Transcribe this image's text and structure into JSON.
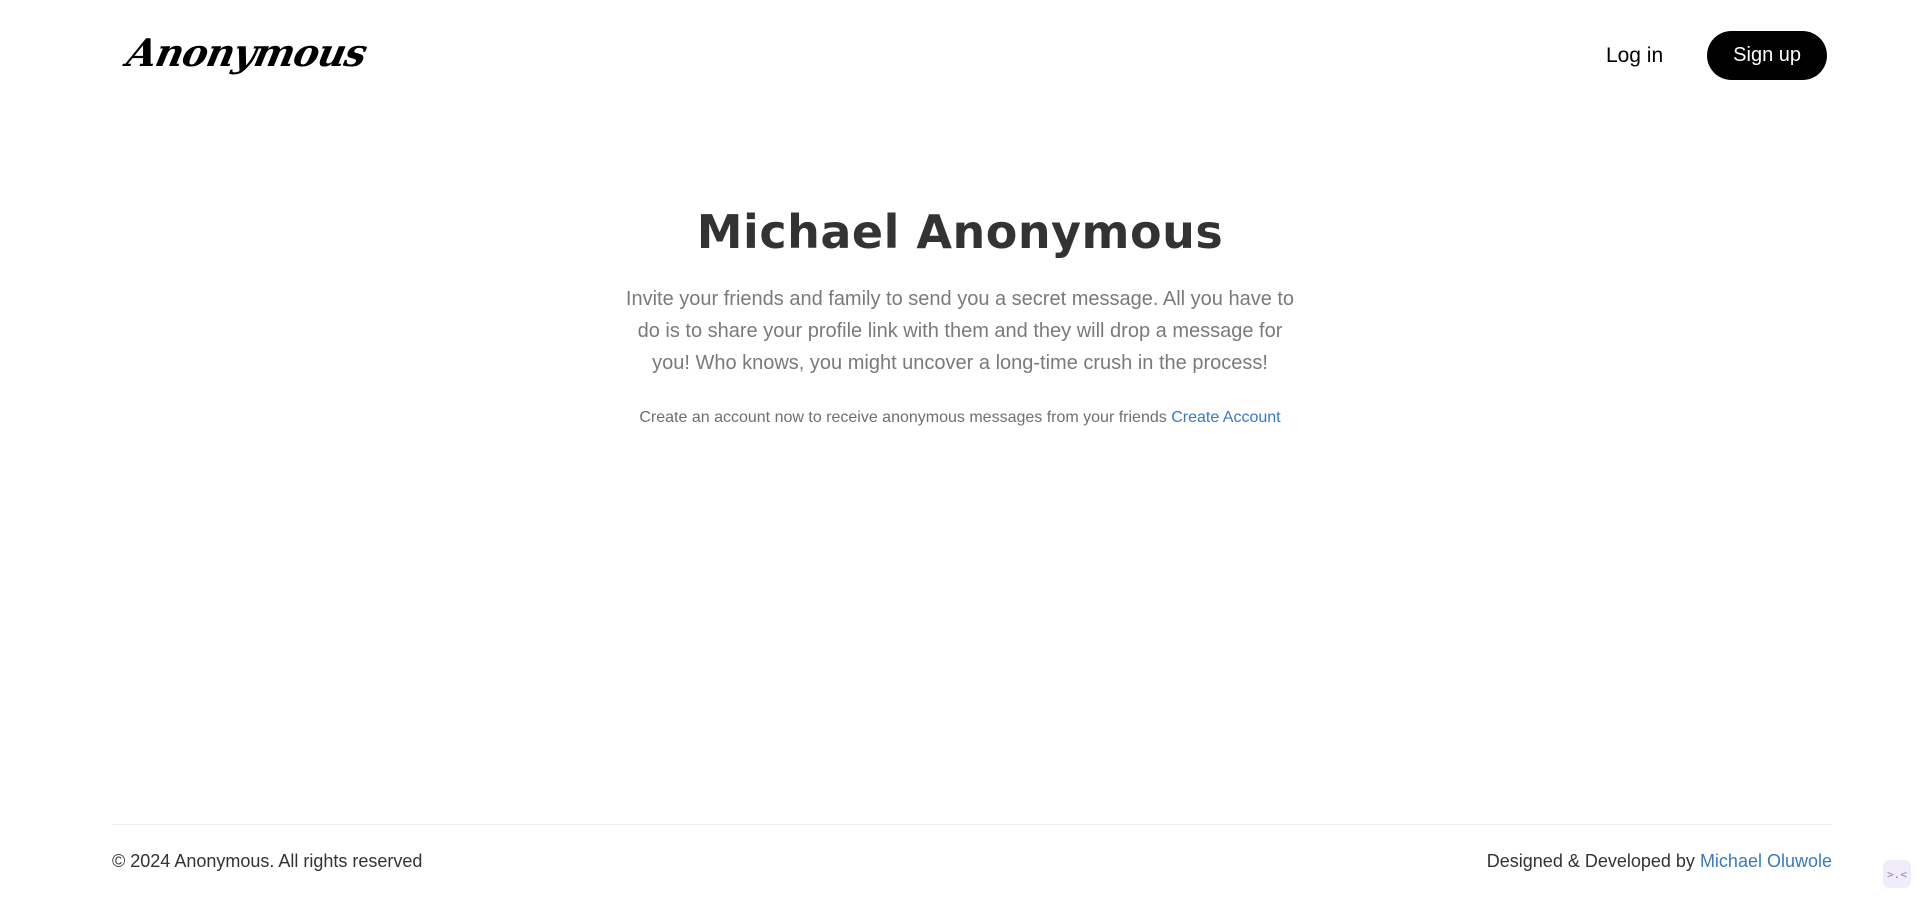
{
  "header": {
    "logo_text": "Anonymous",
    "login_label": "Log in",
    "signup_label": "Sign up"
  },
  "hero": {
    "title": "Michael Anonymous",
    "description": "Invite your friends and family to send you a secret message. All you have to do is to share your profile link with them and they will drop a message for you! Who knows, you might uncover a long-time crush in the process!",
    "cta_text": "Create an account now to receive anonymous messages from your friends",
    "cta_link_label": "Create Account"
  },
  "footer": {
    "copyright": "© 2024 Anonymous. All rights reserved",
    "credit_prefix": "Designed & Developed by",
    "developer_name": "Michael Oluwole"
  },
  "corner_widget": {
    "icon": "code-toggle-icon",
    "glyph": ">.<"
  },
  "colors": {
    "text_primary": "#333333",
    "text_muted": "#7a7a7a",
    "link": "#3a7ab8",
    "button_bg": "#000000",
    "button_text": "#ffffff"
  }
}
